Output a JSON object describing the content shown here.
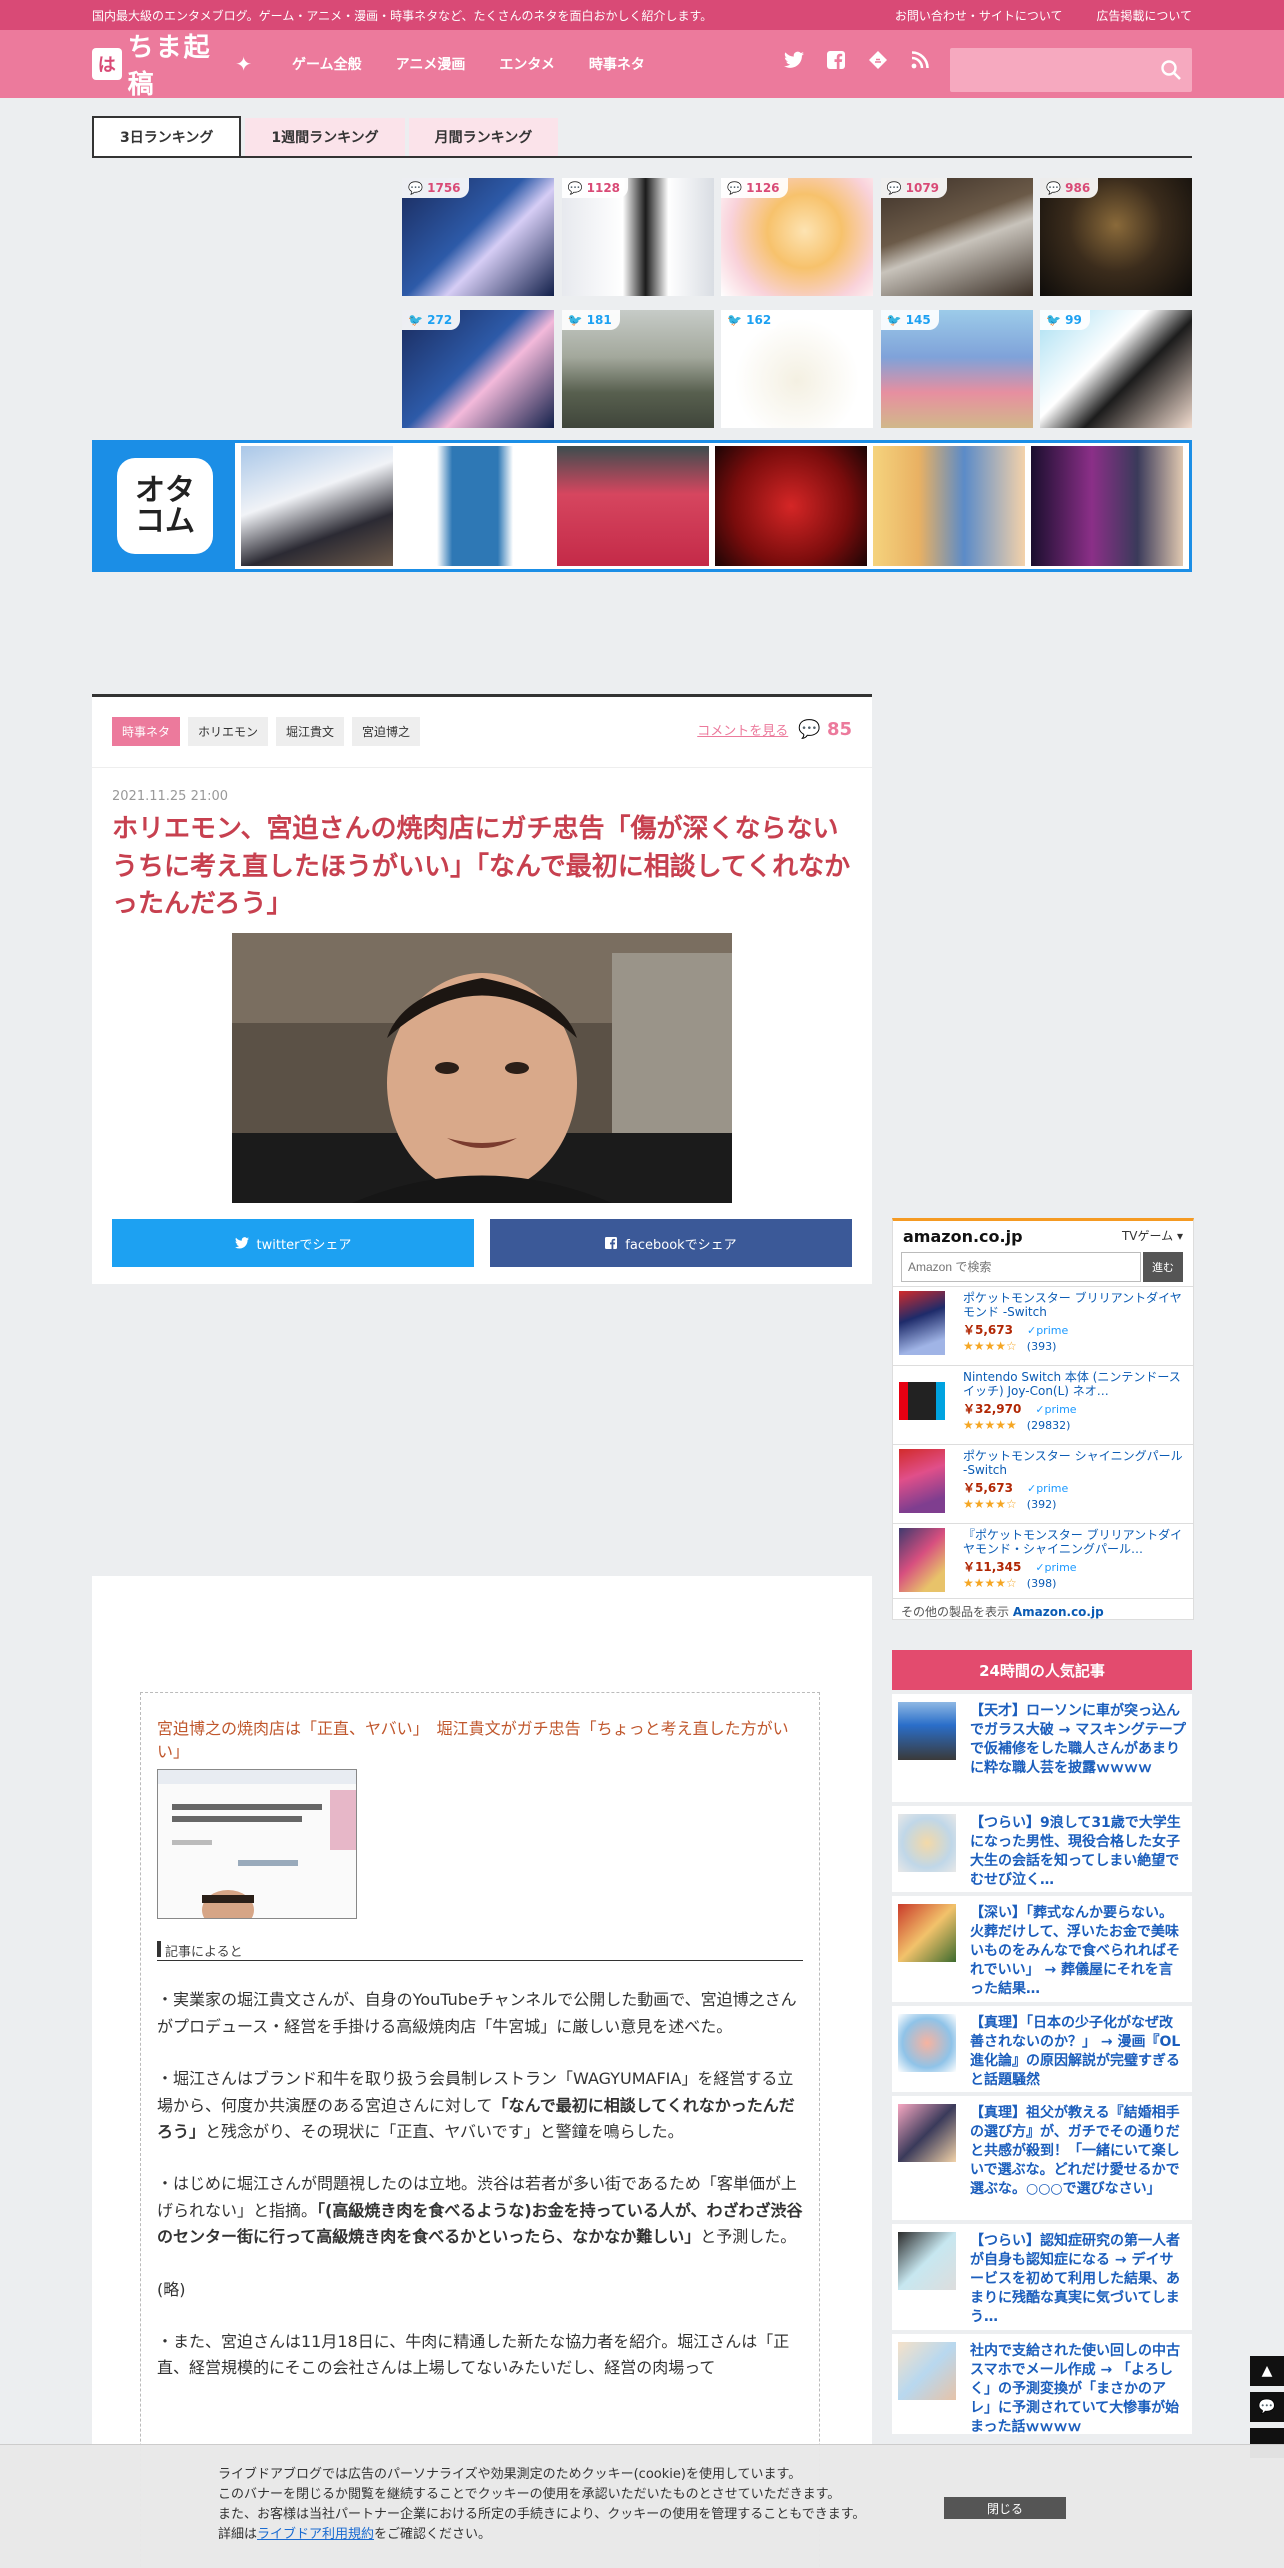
{
  "site": {
    "tagline": "国内最大級のエンタメブログ。ゲーム・アニメ・漫画・時事ネタなど、たくさんのネタを面白おかしく紹介します。",
    "top_links": [
      "お問い合わせ・サイトについて",
      "広告掲載について"
    ],
    "logo_badge": "は",
    "logo_text": "ちま起稿",
    "nav": [
      "ゲーム全般",
      "アニメ漫画",
      "エンタメ",
      "時事ネタ"
    ],
    "social_icons": [
      "twitter-icon",
      "facebook-icon",
      "feedly-icon",
      "rss-icon"
    ],
    "search_placeholder": ""
  },
  "ranking": {
    "tabs": [
      "3日ランキング",
      "1週間ランキング",
      "月間ランキング"
    ],
    "active_tab": 0,
    "comment_counts": [
      "1756",
      "1128",
      "1126",
      "1079",
      "986"
    ],
    "tweet_counts": [
      "272",
      "181",
      "162",
      "145",
      "99"
    ]
  },
  "otacom": {
    "logo": "オタ\nコム"
  },
  "article": {
    "tags": [
      "時事ネタ",
      "ホリエモン",
      "堀江貴文",
      "宮迫博之"
    ],
    "comment_link": "コメントを見る",
    "comment_count": "85",
    "date": "2021.11.25 21:00",
    "title": "ホリエモン、宮迫さんの焼肉店にガチ忠告「傷が深くならないうちに考え直したほうがいい」「なんで最初に相談してくれなかったんだろう」",
    "share_twitter": "twitterでシェア",
    "share_facebook": "facebookでシェア"
  },
  "body": {
    "quote_link": "宮迫博之の焼肉店は「正直、ヤバい」　堀江貴文がガチ忠告「ちょっと考え直した方がいい」",
    "source_label": "記事によると",
    "p1": "・実業家の堀江貴文さんが、自身のYouTubeチャンネルで公開した動画で、宮迫博之さんがプロデュース・経営を手掛ける高級焼肉店「牛宮城」に厳しい意見を述べた。",
    "p2a": "・堀江さんはブランド和牛を取り扱う会員制レストラン「WAGYUMAFIA」を経営する立場から、何度か共演歴のある宮迫さんに対して",
    "p2b": "「なんで最初に相談してくれなかったんだろう」",
    "p2c": "と残念がり、その現状に「正直、ヤバいです」と警鐘を鳴らした。",
    "p3a": "・はじめに堀江さんが問題視したのは立地。渋谷は若者が多い街であるため「客単価が上げられない」と指摘。",
    "p3b": "「(高級焼き肉を食べるような)お金を持っている人が、わざわざ渋谷のセンター街に行って高級焼き肉を食べるかといったら、なかなか難しい」",
    "p3c": "と予測した。",
    "p4": "(略)",
    "p5": "・また、宮迫さんは11月18日に、牛肉に精通した新たな協力者を紹介。堀江さんは「正直、経営規模的にそこの会社さんは上場してないみたいだし、経営の肉場って"
  },
  "amazon": {
    "logo": "amazon.co.jp",
    "category": "TVゲーム",
    "search_placeholder": "Amazon で検索",
    "go": "進む",
    "items": [
      {
        "name": "ポケットモンスター ブリリアントダイヤモンド -Switch",
        "price": "￥5,673",
        "prime": "prime",
        "stars": "★★★★☆",
        "reviews": "(393)"
      },
      {
        "name": "Nintendo Switch 本体 (ニンテンドースイッチ) Joy-Con(L) ネオ…",
        "price": "￥32,970",
        "prime": "prime",
        "stars": "★★★★★",
        "reviews": "(29832)"
      },
      {
        "name": "ポケットモンスター シャイニングパール -Switch",
        "price": "￥5,673",
        "prime": "prime",
        "stars": "★★★★☆",
        "reviews": "(392)"
      },
      {
        "name": "『ポケットモンスター ブリリアントダイヤモンド・シャイニングパール…",
        "price": "￥11,345",
        "prime": "prime",
        "stars": "★★★★☆",
        "reviews": "(398)"
      }
    ],
    "footer_a": "その他の製品を表示",
    "footer_b": "Amazon.co.jp"
  },
  "popular": {
    "title": "24時間の人気記事",
    "items": [
      "【天才】ローソンに車が突っ込んでガラス大破 → マスキングテープで仮補修をした職人さんがあまりに粋な職人芸を披露ｗｗｗｗ",
      "【つらい】9浪して31歳で大学生になった男性、現役合格した女子大生の会話を知ってしまい絶望でむせび泣く…",
      "【深い】「葬式なんか要らない。火葬だけして、浮いたお金で美味いものをみんなで食べられればそれでいい」 → 葬儀屋にそれを言った結果…",
      "【真理】「日本の少子化がなぜ改善されないのか？」 → 漫画『OL進化論』の原因解説が完璧すぎると話題騒然",
      "【真理】祖父が教える『結婚相手の選び方』が、ガチでその通りだと共感が殺到！「一緒にいて楽しいで選ぶな。どれだけ愛せるかで選ぶな。○○○で選びなさい」",
      "【つらい】認知症研究の第一人者が自身も認知症になる → デイサービスを初めて利用した結果、あまりに残酷な真実に気づいてしまう…",
      "社内で支給された使い回しの中古スマホでメール作成 → 「よろしく」の予測変換が「まさかのアレ」に予測されていて大惨事が始まった話ｗｗｗｗ"
    ]
  },
  "floaters": [
    "▲",
    "💬",
    ""
  ],
  "cookie": {
    "line1": "ライブドアブログでは広告のパーソナライズや効果測定のためクッキー(cookie)を使用しています。",
    "line2": "このバナーを閉じるか閲覧を継続することでクッキーの使用を承認いただいたものとさせていただきます。",
    "line3": "また、お客様は当社パートナー企業における所定の手続きにより、クッキーの使用を管理することもできます。",
    "line4a": "詳細は",
    "line4b": "ライブドア利用規約",
    "line4c": "をご確認ください。",
    "close": "閉じる"
  }
}
